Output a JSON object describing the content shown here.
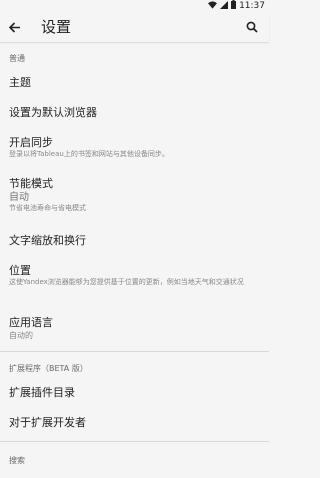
{
  "status_bar": {
    "time": "11:37"
  },
  "toolbar": {
    "title": "设置"
  },
  "sections": {
    "general_header": "普通",
    "extensions_header": "扩展程序（BETA 版）",
    "search_header": "搜索"
  },
  "items": {
    "theme": {
      "title": "主题"
    },
    "default_browser": {
      "title": "设置为默认浏览器"
    },
    "sync": {
      "title": "开启同步",
      "desc": "登录以将Tableau上的书签和网站与其他设备同步。"
    },
    "power_saving": {
      "title": "节能模式",
      "value": "自动",
      "desc": "节省电池寿命与省电模式"
    },
    "text_zoom": {
      "title": "文字缩放和换行"
    },
    "location": {
      "title": "位置",
      "desc": "这使Yandex浏览器能够为您提供基于位置的更新，例如当地天气和交通状况"
    },
    "language": {
      "title": "应用语言",
      "value": "自动的"
    },
    "extensions_catalog": {
      "title": "扩展插件目录"
    },
    "for_developers": {
      "title": "对于扩展开发者"
    }
  }
}
